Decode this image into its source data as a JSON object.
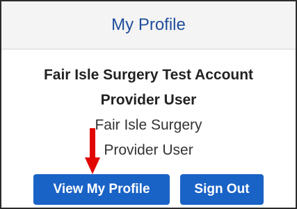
{
  "panel": {
    "title": "My Profile"
  },
  "profile": {
    "account_name": "Fair Isle Surgery Test Account",
    "role_bold": "Provider User",
    "organization": "Fair Isle Surgery",
    "role": "Provider User"
  },
  "actions": {
    "view_profile_label": "View My Profile",
    "sign_out_label": "Sign Out"
  },
  "colors": {
    "title": "#1f4e9a",
    "button": "#1a63c6",
    "annotation_arrow": "#e10600"
  }
}
